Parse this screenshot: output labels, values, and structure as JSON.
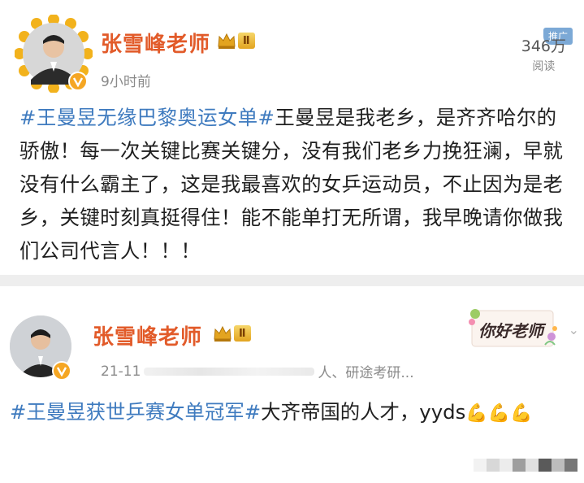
{
  "post1": {
    "author": "张雪峰老师",
    "level": "Ⅱ",
    "time": "9小时前",
    "reads_count": "346万",
    "reads_label": "阅读",
    "promo_label": "推广",
    "hashtag": "#王曼昱无缘巴黎奥运女单#",
    "text": "王曼昱是我老乡，是齐齐哈尔的骄傲！每一次关键比赛关键分，没有我们老乡力挽狂澜，早就没有什么霸主了，这是我最喜欢的女乒运动员，不止因为是老乡，关键时刻真挺得住！能不能单打无所谓，我早晚请你做我们公司代言人！！！"
  },
  "post2": {
    "author": "张雪峰老师",
    "level": "Ⅱ",
    "date": "21-11",
    "source": "人、研途考研...",
    "sticker_text": "你好老师",
    "hashtag": "#王曼昱获世乒赛女单冠军#",
    "text": "大齐帝国的人才，yyds",
    "emoji": "💪"
  },
  "colors": {
    "author": "#e25b2a",
    "hashtag": "#3f7bbf",
    "verified_badge": "#f5a623"
  },
  "icons": [
    "avatar-sunflower-frame",
    "verified-v-icon",
    "crown-icon",
    "chevron-down-icon",
    "flex-arm-emoji"
  ]
}
